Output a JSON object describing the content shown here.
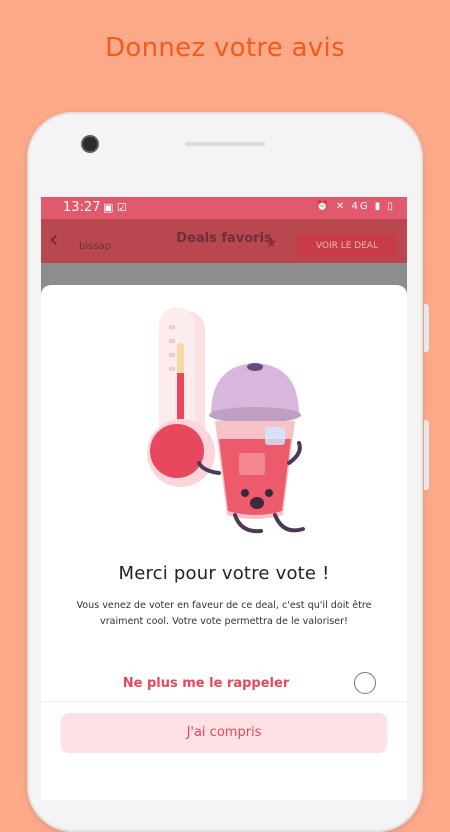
{
  "headline": "Donnez votre avis",
  "status_bar": {
    "time": "13:27",
    "left_icons": [
      "image-icon",
      "check-box-icon"
    ],
    "right_icons": [
      "alarm-icon",
      "mute-icon",
      "network-4g-icon",
      "signal-icon",
      "battery-icon"
    ],
    "network_label": "4G"
  },
  "app_bar": {
    "title": "Deals favoris",
    "subtitle": "bissap",
    "deal_button": "VOIR LE DEAL"
  },
  "dialog": {
    "title": "Merci pour votre vote !",
    "body": "Vous venez de voter en faveur de ce deal, c'est qu'il doit être vraiment cool. Votre vote permettra de le valoriser!",
    "remind_label": "Ne plus me le rappeler",
    "remind_checked": false,
    "confirm_button": "J'ai compris"
  },
  "colors": {
    "background": "#fca98a",
    "headline": "#f25c1a",
    "accent": "#e8475d",
    "button_bg": "#fde1e5"
  }
}
